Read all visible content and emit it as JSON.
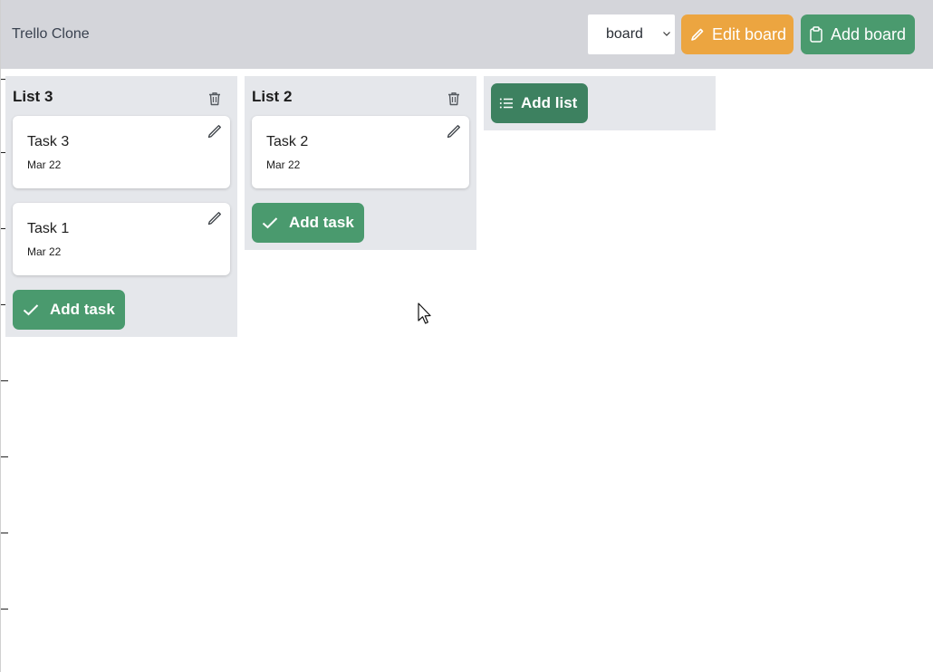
{
  "header": {
    "app_title": "Trello Clone",
    "board_select": {
      "value": "board"
    },
    "edit_board_label": "Edit board",
    "add_board_label": "Add board"
  },
  "lists": [
    {
      "title": "List 3",
      "cards": [
        {
          "title": "Task 3",
          "date": "Mar 22"
        },
        {
          "title": "Task 1",
          "date": "Mar 22"
        }
      ],
      "add_task_label": "Add task"
    },
    {
      "title": "List 2",
      "cards": [
        {
          "title": "Task 2",
          "date": "Mar 22"
        }
      ],
      "add_task_label": "Add task"
    }
  ],
  "add_list_label": "Add list",
  "colors": {
    "header_bg": "#d4d5da",
    "list_bg": "#e5e7eb",
    "edit_button": "#eca540",
    "green_button": "#4a9a6e",
    "add_list_button": "#3d8160"
  },
  "icons": {
    "edit_board": "pencil-icon",
    "add_board": "clipboard-icon",
    "delete_list": "trash-icon",
    "edit_card": "pencil-icon",
    "add_task": "check-icon",
    "add_list": "list-icon",
    "select": "chevron-down-icon"
  }
}
